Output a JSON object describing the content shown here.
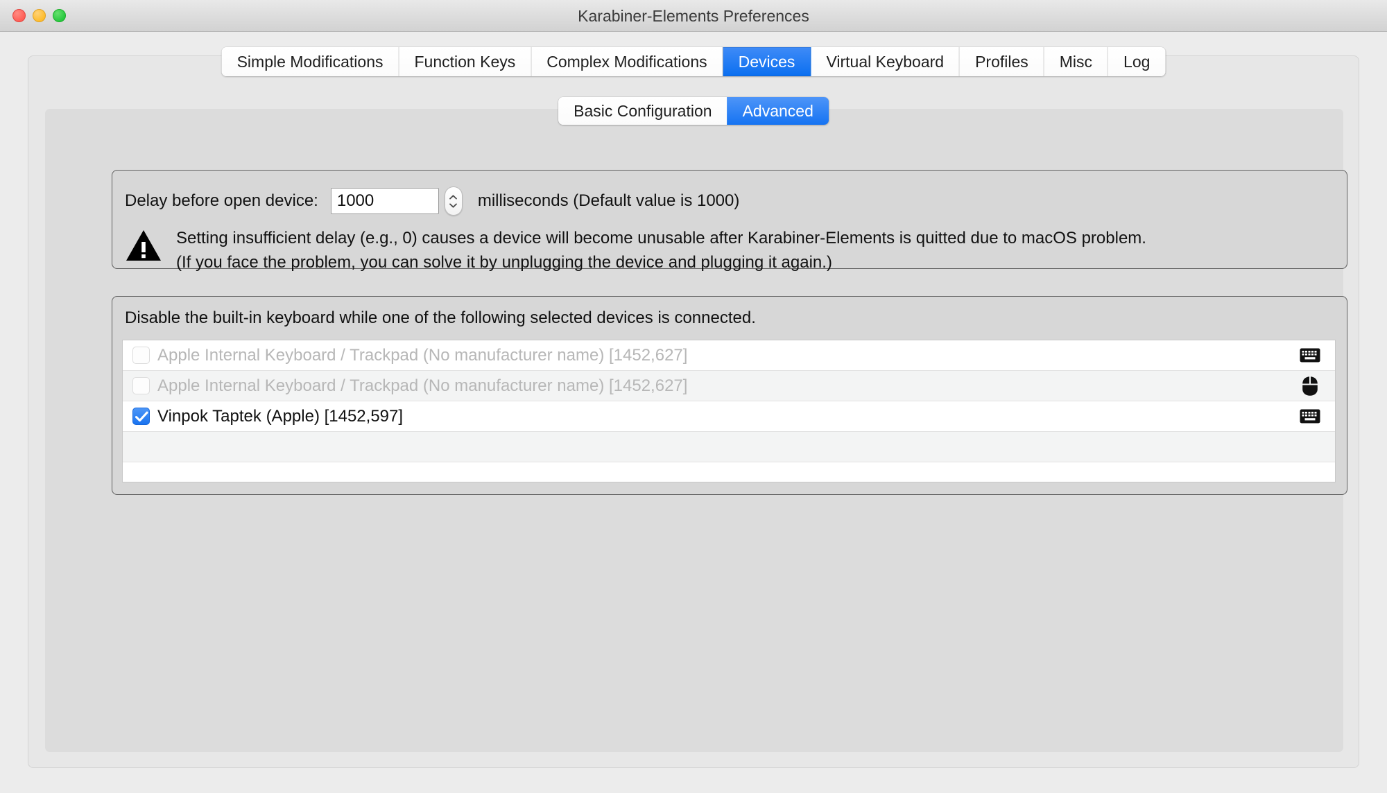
{
  "window": {
    "title": "Karabiner-Elements Preferences",
    "traffic_lights": [
      {
        "name": "close",
        "color": "#ff5f57"
      },
      {
        "name": "minimize",
        "color": "#febc2e"
      },
      {
        "name": "zoom",
        "color": "#28c840"
      }
    ]
  },
  "tabs": [
    {
      "label": "Simple Modifications",
      "active": false
    },
    {
      "label": "Function Keys",
      "active": false
    },
    {
      "label": "Complex Modifications",
      "active": false
    },
    {
      "label": "Devices",
      "active": true
    },
    {
      "label": "Virtual Keyboard",
      "active": false
    },
    {
      "label": "Profiles",
      "active": false
    },
    {
      "label": "Misc",
      "active": false
    },
    {
      "label": "Log",
      "active": false
    }
  ],
  "subtabs": [
    {
      "label": "Basic Configuration",
      "active": false
    },
    {
      "label": "Advanced",
      "active": true
    }
  ],
  "delay": {
    "label": "Delay before open device:",
    "value": "1000",
    "placeholder": "1000",
    "suffix": "milliseconds (Default value is 1000)",
    "stepper_up_icon": "chevron-up-icon",
    "stepper_down_icon": "chevron-down-icon"
  },
  "warning": {
    "icon": "warning-triangle-icon",
    "line1": "Setting insufficient delay (e.g., 0) causes a device will become unusable after Karabiner-Elements is quitted due to macOS problem.",
    "line2": "(If you face the problem, you can solve it by unplugging the device and plugging it again.)"
  },
  "devices": {
    "caption": "Disable the built-in keyboard while one of the following selected devices is connected.",
    "rows": [
      {
        "label": "Apple Internal Keyboard / Trackpad (No manufacturer name) [1452,627]",
        "checked": false,
        "disabled": true,
        "icon": "keyboard-icon"
      },
      {
        "label": "Apple Internal Keyboard / Trackpad (No manufacturer name) [1452,627]",
        "checked": false,
        "disabled": true,
        "icon": "mouse-icon"
      },
      {
        "label": "Vinpok Taptek (Apple) [1452,597]",
        "checked": true,
        "disabled": false,
        "icon": "keyboard-icon"
      },
      {
        "label": "",
        "checked": false,
        "disabled": false,
        "icon": ""
      },
      {
        "label": "",
        "checked": false,
        "disabled": false,
        "icon": ""
      }
    ]
  },
  "colors": {
    "accent": "#0a6ff0",
    "window_background": "#ececec",
    "panel_background": "#e7e7e7",
    "inner_panel_background": "#dcdcdc",
    "groupbox_background": "#d7d7d7",
    "disabled_text": "#b7b7b7"
  }
}
